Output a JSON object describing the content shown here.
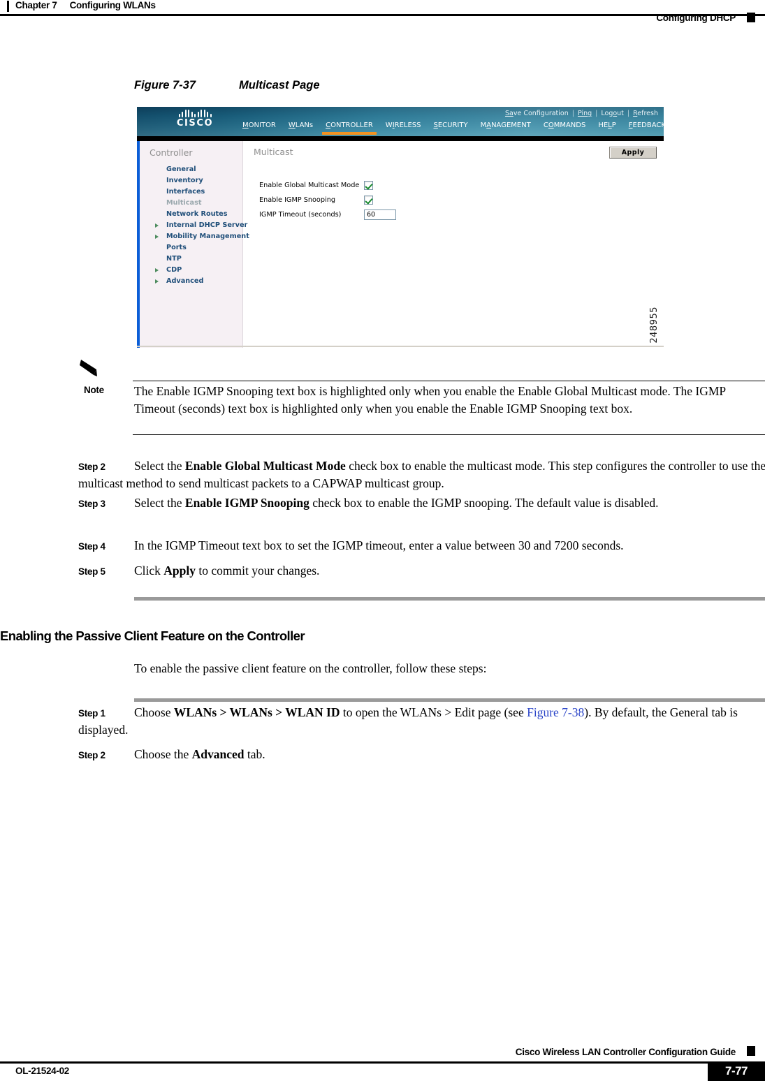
{
  "header": {
    "chapter_num": "Chapter 7",
    "chapter_title": "Configuring WLANs",
    "section_right": "Configuring DHCP"
  },
  "figure": {
    "number": "Figure 7-37",
    "title": "Multicast Page",
    "id_label": "248955"
  },
  "screenshot": {
    "brand": "CISCO",
    "utility_links": [
      "Save Configuration",
      "Ping",
      "Logout",
      "Refresh"
    ],
    "nav": [
      {
        "label": "MONITOR",
        "active": false
      },
      {
        "label": "WLANs",
        "active": false
      },
      {
        "label": "CONTROLLER",
        "active": true
      },
      {
        "label": "WIRELESS",
        "active": false
      },
      {
        "label": "SECURITY",
        "active": false
      },
      {
        "label": "MANAGEMENT",
        "active": false
      },
      {
        "label": "COMMANDS",
        "active": false
      },
      {
        "label": "HELP",
        "active": false
      },
      {
        "label": "FEEDBACK",
        "active": false
      }
    ],
    "sidebar": {
      "title": "Controller",
      "items": [
        {
          "label": "General",
          "expandable": false,
          "current": false
        },
        {
          "label": "Inventory",
          "expandable": false,
          "current": false
        },
        {
          "label": "Interfaces",
          "expandable": false,
          "current": false
        },
        {
          "label": "Multicast",
          "expandable": false,
          "current": true
        },
        {
          "label": "Network Routes",
          "expandable": false,
          "current": false
        },
        {
          "label": "Internal DHCP Server",
          "expandable": true,
          "current": false
        },
        {
          "label": "Mobility Management",
          "expandable": true,
          "current": false
        },
        {
          "label": "Ports",
          "expandable": false,
          "current": false
        },
        {
          "label": "NTP",
          "expandable": false,
          "current": false
        },
        {
          "label": "CDP",
          "expandable": true,
          "current": false
        },
        {
          "label": "Advanced",
          "expandable": true,
          "current": false
        }
      ]
    },
    "main": {
      "title": "Multicast",
      "apply_label": "Apply",
      "fields": {
        "global_multicast_label": "Enable Global Multicast Mode",
        "global_multicast_checked": true,
        "igmp_snooping_label": "Enable IGMP Snooping",
        "igmp_snooping_checked": true,
        "igmp_timeout_label": "IGMP Timeout (seconds)",
        "igmp_timeout_value": "60"
      }
    }
  },
  "note": {
    "label": "Note",
    "text": "The Enable IGMP Snooping text box is highlighted only when you enable the Enable Global Multicast mode. The IGMP Timeout (seconds) text box is highlighted only when you enable the Enable IGMP Snooping text box."
  },
  "steps_multicast": [
    {
      "label": "Step 2",
      "parts": [
        {
          "t": "Select the ",
          "b": false
        },
        {
          "t": "Enable Global Multicast Mode",
          "b": true
        },
        {
          "t": " check box to enable the multicast mode. This step configures the controller to use the multicast method to send multicast packets to a CAPWAP multicast group.",
          "b": false
        }
      ]
    },
    {
      "label": "Step 3",
      "parts": [
        {
          "t": "Select the ",
          "b": false
        },
        {
          "t": "Enable IGMP Snooping",
          "b": true
        },
        {
          "t": " check box to enable the IGMP snooping. The default value is disabled.",
          "b": false
        }
      ]
    },
    {
      "label": "Step 4",
      "parts": [
        {
          "t": "In the IGMP Timeout text box to set the IGMP timeout, enter a value between 30 and 7200 seconds.",
          "b": false
        }
      ]
    },
    {
      "label": "Step 5",
      "parts": [
        {
          "t": "Click ",
          "b": false
        },
        {
          "t": "Apply",
          "b": true
        },
        {
          "t": " to commit your changes.",
          "b": false
        }
      ]
    }
  ],
  "section": {
    "heading": "Enabling the Passive Client Feature on the Controller",
    "intro": "To enable the passive client feature on the controller, follow these steps:"
  },
  "steps_passive": [
    {
      "label": "Step 1",
      "parts": [
        {
          "t": "Choose ",
          "b": false
        },
        {
          "t": "WLANs > WLANs > WLAN ID",
          "b": true
        },
        {
          "t": " to open the WLANs > Edit page (see ",
          "b": false
        },
        {
          "t": "Figure 7-38",
          "b": false,
          "x": true
        },
        {
          "t": "). By default, the General tab is displayed.",
          "b": false
        }
      ]
    },
    {
      "label": "Step 2",
      "parts": [
        {
          "t": "Choose the ",
          "b": false
        },
        {
          "t": "Advanced",
          "b": true
        },
        {
          "t": " tab.",
          "b": false
        }
      ]
    }
  ],
  "footer": {
    "guide": "Cisco Wireless LAN Controller Configuration Guide",
    "doc_id": "OL-21524-02",
    "page": "7-77"
  }
}
